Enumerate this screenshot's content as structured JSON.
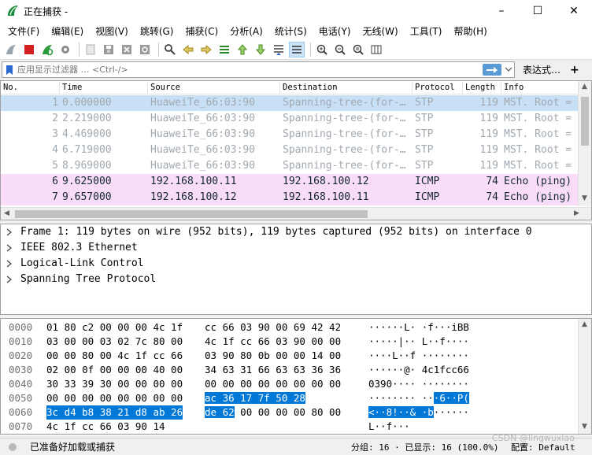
{
  "window": {
    "title": "正在捕获 -",
    "minimize": "–",
    "maximize": "☐",
    "close": "✕"
  },
  "menu": [
    "文件(F)",
    "编辑(E)",
    "视图(V)",
    "跳转(G)",
    "捕获(C)",
    "分析(A)",
    "统计(S)",
    "电话(Y)",
    "无线(W)",
    "工具(T)",
    "帮助(H)"
  ],
  "filter": {
    "placeholder": "应用显示过滤器 … <Ctrl-/>",
    "expression_label": "表达式…",
    "add": "+"
  },
  "columns": [
    "No.",
    "Time",
    "Source",
    "Destination",
    "Protocol",
    "Length",
    "Info"
  ],
  "packets": [
    {
      "no": "1",
      "time": "0.000000",
      "src": "HuaweiTe_66:03:90",
      "dst": "Spanning-tree-(for-…",
      "proto": "STP",
      "len": "119",
      "info": "MST. Root ="
    },
    {
      "no": "2",
      "time": "2.219000",
      "src": "HuaweiTe_66:03:90",
      "dst": "Spanning-tree-(for-…",
      "proto": "STP",
      "len": "119",
      "info": "MST. Root ="
    },
    {
      "no": "3",
      "time": "4.469000",
      "src": "HuaweiTe_66:03:90",
      "dst": "Spanning-tree-(for-…",
      "proto": "STP",
      "len": "119",
      "info": "MST. Root ="
    },
    {
      "no": "4",
      "time": "6.719000",
      "src": "HuaweiTe_66:03:90",
      "dst": "Spanning-tree-(for-…",
      "proto": "STP",
      "len": "119",
      "info": "MST. Root ="
    },
    {
      "no": "5",
      "time": "8.969000",
      "src": "HuaweiTe_66:03:90",
      "dst": "Spanning-tree-(for-…",
      "proto": "STP",
      "len": "119",
      "info": "MST. Root ="
    },
    {
      "no": "6",
      "time": "9.625000",
      "src": "192.168.100.11",
      "dst": "192.168.100.12",
      "proto": "ICMP",
      "len": "74",
      "info": "Echo (ping)"
    },
    {
      "no": "7",
      "time": "9.657000",
      "src": "192.168.100.12",
      "dst": "192.168.100.11",
      "proto": "ICMP",
      "len": "74",
      "info": "Echo (ping)"
    }
  ],
  "details": [
    "Frame 1: 119 bytes on wire (952 bits), 119 bytes captured (952 bits) on interface 0",
    "IEEE 802.3 Ethernet",
    "Logical-Link Control",
    "Spanning Tree Protocol"
  ],
  "hex_rows": [
    {
      "offset": "0000",
      "a": "01 80 c2 00 00 00 4c 1f",
      "b": "cc 66 03 90 00 69 42 42",
      "ascii": "······L· ·f···iBB"
    },
    {
      "offset": "0010",
      "a": "03 00 00 03 02 7c 80 00",
      "b": "4c 1f cc 66 03 90 00 00",
      "ascii": "·····|·· L··f····"
    },
    {
      "offset": "0020",
      "a": "00 00 80 00 4c 1f cc 66",
      "b": "03 90 80 0b 00 00 14 00",
      "ascii": "····L··f ········"
    },
    {
      "offset": "0030",
      "a": "02 00 0f 00 00 00 40 00",
      "b": "34 63 31 66 63 63 36 36",
      "ascii": "······@· 4c1fcc66"
    },
    {
      "offset": "0040",
      "a": "30 33 39 30 00 00 00 00",
      "b": "00 00 00 00 00 00 00 00",
      "ascii": "0390···· ········"
    },
    {
      "offset": "0050",
      "a": "00 00 00 00 00 00 00 00",
      "b_plain": "",
      "b_hl": "ac 36 17 7f 50 28",
      "ascii_plain": "········ ··",
      "ascii_hl": "·6··P("
    },
    {
      "offset": "0060",
      "a_hl": "3c d4 b8 38 21 d8 ab 26",
      "b_hl": "de 62",
      "b_plain": " 00 00 00 00 80 00",
      "ascii_hl": "<··8!··& ·b",
      "ascii_plain": "······"
    },
    {
      "offset": "0070",
      "a": "4c 1f cc 66 03 90 14",
      "b": "",
      "ascii": "L··f···"
    }
  ],
  "status": {
    "ready": "已准备好加载或捕获",
    "stats": "分组: 16 · 已显示: 16 (100.0%)",
    "profile": "配置: Default"
  },
  "watermark": "CSDN @lingwuxiao"
}
